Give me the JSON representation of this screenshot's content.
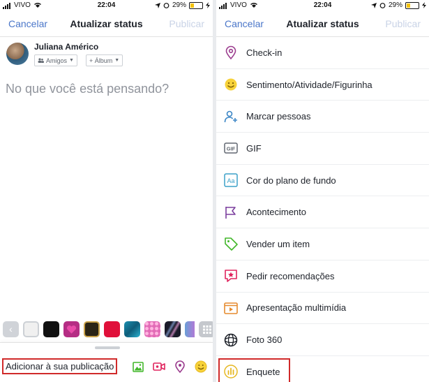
{
  "status_bar": {
    "carrier": "VIVO",
    "time": "22:04",
    "battery": "29%",
    "battery_level": 0.29
  },
  "nav": {
    "cancel_label": "Cancelar",
    "title": "Atualizar status",
    "publish_label": "Publicar"
  },
  "composer": {
    "user_name": "Juliana Américo",
    "audience_label": "Amigos",
    "album_label": "+ Álbum",
    "placeholder": "No que você está pensando?"
  },
  "backgrounds": [
    "#f0f0f0",
    "#111111",
    "#b52d84",
    "#2a2416",
    "#e0103a",
    "#1b8fb0",
    "#e26ab6",
    "#1b1b2a",
    "#6a9fd6"
  ],
  "bottom_bar": {
    "add_label": "Adicionar à sua publicação",
    "icons": [
      "photo-icon",
      "video-icon",
      "location-pin-icon",
      "emoji-icon"
    ]
  },
  "menu": [
    {
      "label": "Check-in",
      "icon": "location-pin-icon",
      "color": "#9b3c8e"
    },
    {
      "label": "Sentimento/Atividade/Figurinha",
      "icon": "smiley-icon",
      "color": "#e6b822"
    },
    {
      "label": "Marcar pessoas",
      "icon": "tag-people-icon",
      "color": "#3b86c6"
    },
    {
      "label": "GIF",
      "icon": "gif-icon",
      "color": "#606770"
    },
    {
      "label": "Cor do plano de fundo",
      "icon": "aa-background-icon",
      "color": "#3aa0c8"
    },
    {
      "label": "Acontecimento",
      "icon": "flag-icon",
      "color": "#7b3f9e"
    },
    {
      "label": "Vender um item",
      "icon": "price-tag-icon",
      "color": "#42b72a"
    },
    {
      "label": "Pedir recomendações",
      "icon": "recommendation-icon",
      "color": "#e0245e"
    },
    {
      "label": "Apresentação multimídia",
      "icon": "slideshow-icon",
      "color": "#e58a2e"
    },
    {
      "label": "Foto 360",
      "icon": "photo-360-icon",
      "color": "#1d2129"
    },
    {
      "label": "Enquete",
      "icon": "poll-icon",
      "color": "#e6b822"
    }
  ]
}
